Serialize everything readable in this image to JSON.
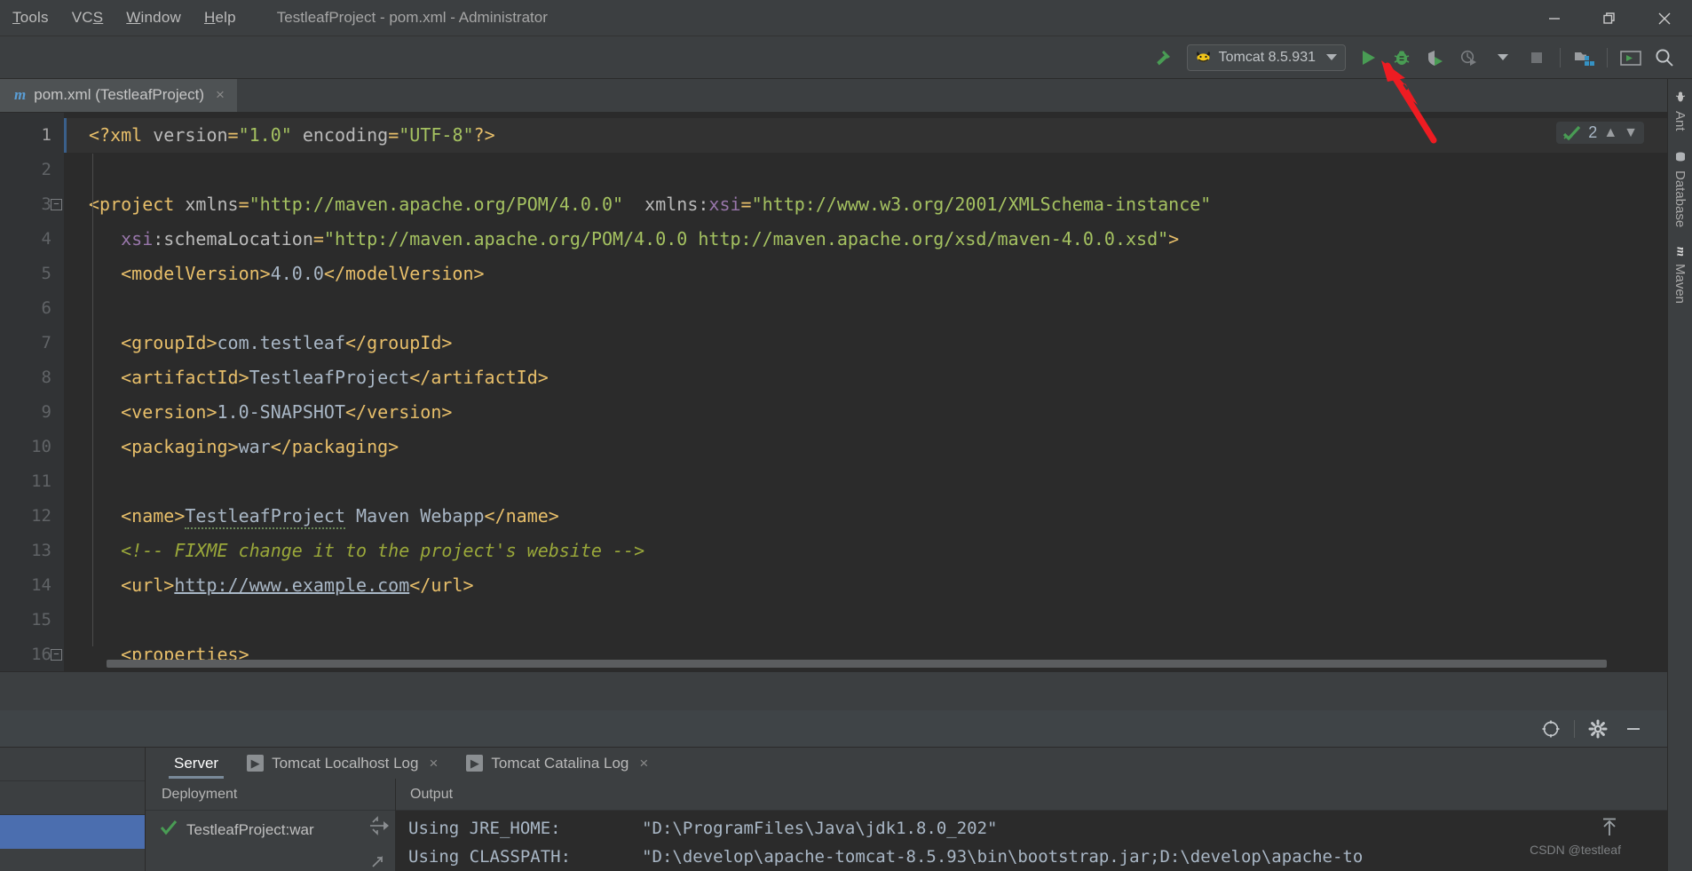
{
  "window": {
    "title": "TestleafProject - pom.xml - Administrator",
    "menu": [
      {
        "label": "Tools",
        "mnemonic": "T"
      },
      {
        "label": "VCS",
        "mnemonic": "S"
      },
      {
        "label": "Window",
        "mnemonic": "W"
      },
      {
        "label": "Help",
        "mnemonic": "H"
      }
    ],
    "controls": {
      "minimize": "minimize-icon",
      "restore": "restore-icon",
      "close": "close-icon"
    }
  },
  "toolbar": {
    "build_icon": "hammer-icon",
    "run_config": {
      "name": "Tomcat 8.5.931",
      "icon": "tomcat-icon",
      "dropdown": "chevron-down-icon"
    },
    "actions": [
      {
        "name": "run-button",
        "icon": "play-icon"
      },
      {
        "name": "debug-button",
        "icon": "bug-icon"
      },
      {
        "name": "run-with-coverage-button",
        "icon": "coverage-icon"
      },
      {
        "name": "profile-button",
        "icon": "profiler-icon"
      },
      {
        "name": "stop-button",
        "icon": "stop-icon"
      },
      {
        "name": "project-structure-button",
        "icon": "project-structure-icon"
      },
      {
        "name": "terminal-button",
        "icon": "terminal-icon"
      },
      {
        "name": "search-everywhere-button",
        "icon": "search-icon"
      }
    ]
  },
  "editor_tab": {
    "icon": "maven-m-icon",
    "label": "pom.xml (TestleafProject)",
    "close": "×"
  },
  "inspection": {
    "status_icon": "checkmark-icon",
    "count": "2",
    "prev": "▲",
    "next": "▼"
  },
  "code": {
    "lines": [
      {
        "n": "1",
        "segments": [
          {
            "t": "tag",
            "s": "<?xml "
          },
          {
            "t": "attr",
            "s": "version"
          },
          {
            "t": "tag",
            "s": "="
          },
          {
            "t": "val",
            "s": "\"1.0\""
          },
          {
            "t": "attr",
            "s": " encoding"
          },
          {
            "t": "tag",
            "s": "="
          },
          {
            "t": "val",
            "s": "\"UTF-8\""
          },
          {
            "t": "tag",
            "s": "?>"
          }
        ]
      },
      {
        "n": "2",
        "segments": []
      },
      {
        "n": "3",
        "fold": true,
        "segments": [
          {
            "t": "tag",
            "s": "<project "
          },
          {
            "t": "attr",
            "s": "xmlns"
          },
          {
            "t": "tag",
            "s": "="
          },
          {
            "t": "val",
            "s": "\"http://maven.apache.org/POM/4.0.0\""
          },
          {
            "t": "attr",
            "s": "  xmlns:"
          },
          {
            "t": "ns",
            "s": "xsi"
          },
          {
            "t": "tag",
            "s": "="
          },
          {
            "t": "val",
            "s": "\"http://www.w3.org/2001/XMLSchema-instance\""
          }
        ]
      },
      {
        "n": "4",
        "segments": [
          {
            "t": "txt",
            "s": "   "
          },
          {
            "t": "ns",
            "s": "xsi"
          },
          {
            "t": "attr",
            "s": ":schemaLocation"
          },
          {
            "t": "tag",
            "s": "="
          },
          {
            "t": "val",
            "s": "\"http://maven.apache.org/POM/4.0.0 http://maven.apache.org/xsd/maven-4.0.0.xsd\""
          },
          {
            "t": "tag",
            "s": ">"
          }
        ]
      },
      {
        "n": "5",
        "segments": [
          {
            "t": "txt",
            "s": "   "
          },
          {
            "t": "tag",
            "s": "<modelVersion>"
          },
          {
            "t": "txt",
            "s": "4.0.0"
          },
          {
            "t": "tag",
            "s": "</modelVersion>"
          }
        ]
      },
      {
        "n": "6",
        "segments": []
      },
      {
        "n": "7",
        "segments": [
          {
            "t": "txt",
            "s": "   "
          },
          {
            "t": "tag",
            "s": "<groupId>"
          },
          {
            "t": "txt",
            "s": "com.testleaf"
          },
          {
            "t": "tag",
            "s": "</groupId>"
          }
        ]
      },
      {
        "n": "8",
        "segments": [
          {
            "t": "txt",
            "s": "   "
          },
          {
            "t": "tag",
            "s": "<artifactId>"
          },
          {
            "t": "txt",
            "s": "TestleafProject"
          },
          {
            "t": "tag",
            "s": "</artifactId>"
          }
        ]
      },
      {
        "n": "9",
        "segments": [
          {
            "t": "txt",
            "s": "   "
          },
          {
            "t": "tag",
            "s": "<version>"
          },
          {
            "t": "txt",
            "s": "1.0-SNAPSHOT"
          },
          {
            "t": "tag",
            "s": "</version>"
          }
        ]
      },
      {
        "n": "10",
        "segments": [
          {
            "t": "txt",
            "s": "   "
          },
          {
            "t": "tag",
            "s": "<packaging>"
          },
          {
            "t": "txt",
            "s": "war"
          },
          {
            "t": "tag",
            "s": "</packaging>"
          }
        ]
      },
      {
        "n": "11",
        "segments": []
      },
      {
        "n": "12",
        "segments": [
          {
            "t": "txt",
            "s": "   "
          },
          {
            "t": "tag",
            "s": "<name>"
          },
          {
            "t": "squig",
            "s": "TestleafProject"
          },
          {
            "t": "txt",
            "s": " Maven Webapp"
          },
          {
            "t": "tag",
            "s": "</name>"
          }
        ]
      },
      {
        "n": "13",
        "segments": [
          {
            "t": "txt",
            "s": "   "
          },
          {
            "t": "cmt",
            "s": "<!-- FIXME change it to the project's website -->"
          }
        ]
      },
      {
        "n": "14",
        "segments": [
          {
            "t": "txt",
            "s": "   "
          },
          {
            "t": "tag",
            "s": "<url>"
          },
          {
            "t": "lnk",
            "s": "http://www.example.com"
          },
          {
            "t": "tag",
            "s": "</url>"
          }
        ]
      },
      {
        "n": "15",
        "segments": []
      },
      {
        "n": "16",
        "fold": true,
        "segments": [
          {
            "t": "txt",
            "s": "   "
          },
          {
            "t": "tag",
            "s": "<properties>"
          }
        ]
      }
    ]
  },
  "right_rail": [
    {
      "label": "Ant",
      "icon": "ant-icon"
    },
    {
      "label": "Database",
      "icon": "database-icon"
    },
    {
      "label": "Maven",
      "icon": "maven-m-icon"
    }
  ],
  "run_window": {
    "header_actions": [
      {
        "name": "pin-target-button",
        "icon": "target-icon"
      },
      {
        "name": "settings-button",
        "icon": "gear-icon"
      },
      {
        "name": "hide-button",
        "icon": "minimize-icon"
      }
    ],
    "tabs": [
      {
        "label": "Server",
        "active": true,
        "icon": null,
        "closable": false
      },
      {
        "label": "Tomcat Localhost Log",
        "active": false,
        "icon": "log-icon",
        "closable": true
      },
      {
        "label": "Tomcat Catalina Log",
        "active": false,
        "icon": "log-icon",
        "closable": true
      }
    ],
    "deployment": {
      "header": "Deployment",
      "items": [
        {
          "status_icon": "checkmark-icon",
          "name": "TestleafProject:war"
        }
      ]
    },
    "output": {
      "header": "Output",
      "lines": [
        "Using JRE_HOME:        \"D:\\ProgramFiles\\Java\\jdk1.8.0_202\"",
        "Using CLASSPATH:       \"D:\\develop\\apache-tomcat-8.5.93\\bin\\bootstrap.jar;D:\\develop\\apache-to"
      ],
      "scroll_up_icon": "arrow-up-icon"
    },
    "watermark": "CSDN @testleaf"
  },
  "colors": {
    "accent_blue": "#4b6eaf",
    "run_green": "#499c54",
    "tag_orange": "#e8bf6a",
    "string_green": "#a5c261",
    "comment_green": "#9aa83a",
    "namespace_purple": "#9876aa",
    "annotation_red": "#ee1c22"
  }
}
